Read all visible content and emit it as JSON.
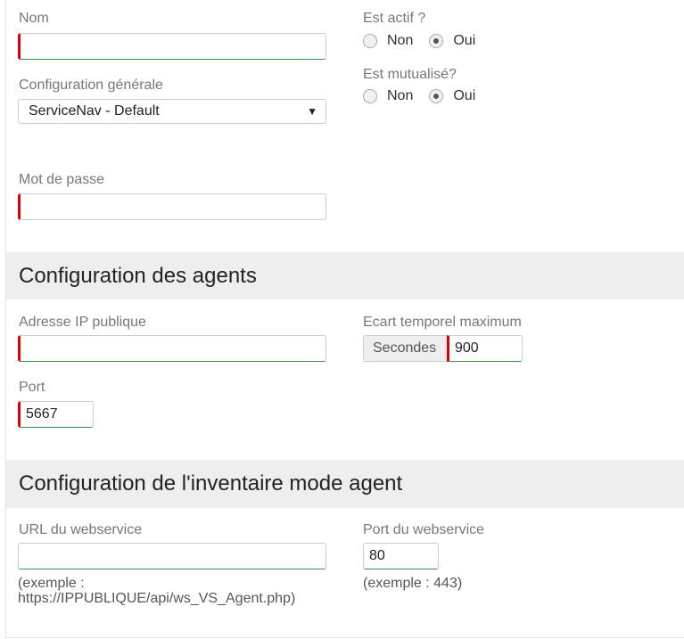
{
  "fields": {
    "nom": {
      "label": "Nom",
      "value": ""
    },
    "config_generale": {
      "label": "Configuration générale",
      "selected": "ServiceNav - Default"
    },
    "mot_de_passe": {
      "label": "Mot de passe",
      "value": ""
    },
    "est_actif": {
      "label": "Est actif ?",
      "options": [
        "Non",
        "Oui"
      ],
      "selected": "Oui"
    },
    "est_mutualise": {
      "label": "Est mutualisé?",
      "options": [
        "Non",
        "Oui"
      ],
      "selected": "Oui"
    }
  },
  "sections": {
    "agents": {
      "title": "Configuration des agents"
    },
    "inventaire": {
      "title": "Configuration de l'inventaire mode agent"
    }
  },
  "agents": {
    "ip_publique": {
      "label": "Adresse IP publique",
      "value": ""
    },
    "ecart": {
      "label": "Ecart temporel maximum",
      "addon": "Secondes",
      "value": "900"
    },
    "port": {
      "label": "Port",
      "value": "5667"
    }
  },
  "inventaire": {
    "url": {
      "label": "URL du webservice",
      "value": "",
      "help_line1": "(exemple :",
      "help_line2": "https://IPPUBLIQUE/api/ws_VS_Agent.php)"
    },
    "port_ws": {
      "label": "Port du webservice",
      "value": "80",
      "help": "(exemple : 443)"
    }
  },
  "colors": {
    "required_marker": "#e00000",
    "valid_border": "#3c8f4c",
    "section_bg": "#eeeeee",
    "label_text": "#777777"
  }
}
